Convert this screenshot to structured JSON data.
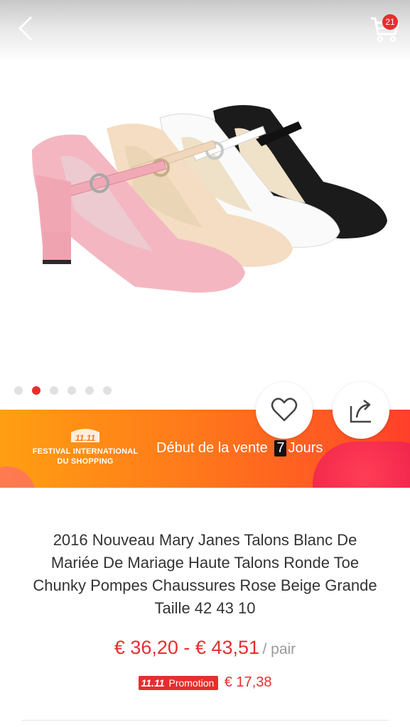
{
  "header": {
    "back_icon": "chevron-left-icon",
    "cart_icon": "shopping-cart-icon",
    "cart_count": "21"
  },
  "gallery": {
    "image_subject": "four Mary Jane block-heel shoes in pink, beige, white and black",
    "slide_count": 6,
    "active_index": 1
  },
  "banner": {
    "festival_name": "FESTIVAL INTERNATIONAL\nDU SHOPPING",
    "logo_number": "11.11",
    "sale_prefix": "Début de la vente",
    "days": "7",
    "sale_suffix": "Jours"
  },
  "actions": {
    "wishlist_icon": "heart-icon",
    "share_icon": "share-icon"
  },
  "product": {
    "title": "2016 Nouveau Mary Janes Talons Blanc De Mariée De Mariage Haute Talons Ronde Toe Chunky Pompes Chaussures Rose Beige Grande Taille 42 43 10",
    "price_range": "€ 36,20 - € 43,51",
    "price_unit": "/ pair",
    "promo_label_number": "11.11",
    "promo_label": "Promotion",
    "promo_price": "€ 17,38"
  },
  "colors": {
    "accent": "#e62e2e",
    "banner_start": "#ff9f12",
    "banner_end": "#ff3f2b"
  }
}
